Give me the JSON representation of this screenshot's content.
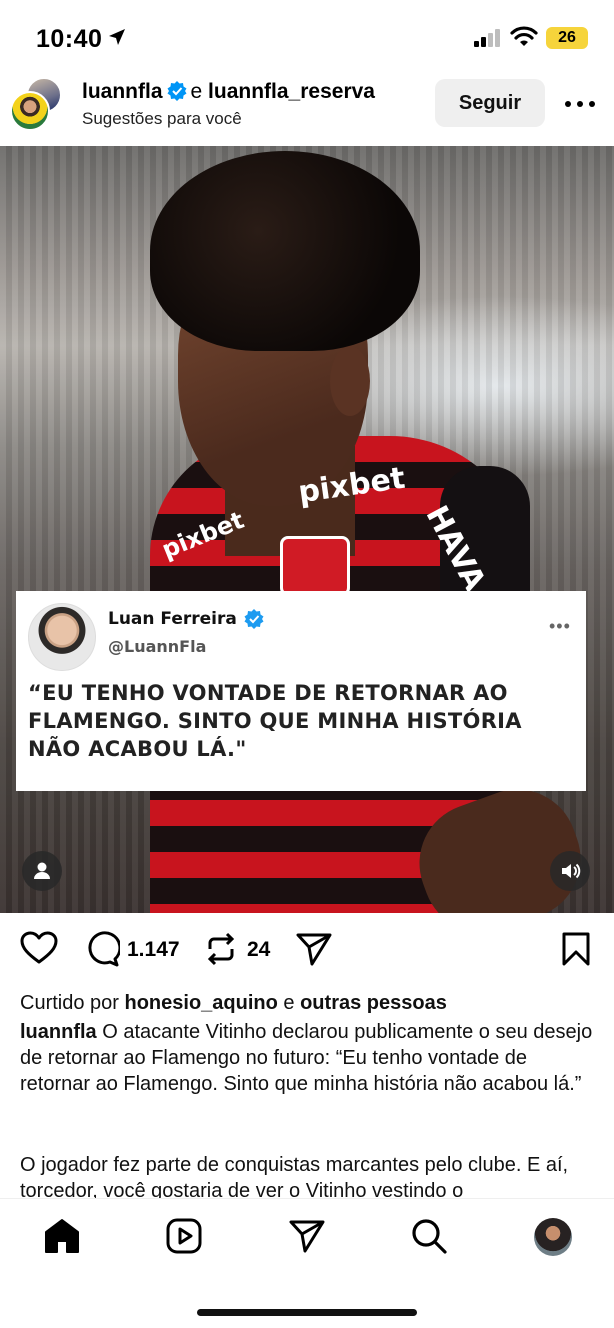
{
  "status_bar": {
    "time": "10:40",
    "battery": "26",
    "battery_color": "#f6d43b"
  },
  "post_header": {
    "user1": "luannfla",
    "conjunction": "e",
    "user2": "luannfla_reserva",
    "subtitle": "Sugestões para você",
    "follow_label": "Seguir"
  },
  "media": {
    "sponsor_text": "pixbet",
    "sponsor_text_2": "pixbet",
    "sleeve_text": "HAVA",
    "tweet": {
      "name": "Luan Ferreira",
      "handle": "@LuannFla",
      "text": "“EU TENHO VONTADE DE RETORNAR AO FLAMENGO. SINTO QUE MINHA HISTÓRIA NÃO ACABOU LÁ.\"",
      "more": "•••"
    }
  },
  "actions": {
    "comments_count": "1.147",
    "reposts_count": "24"
  },
  "likes": {
    "prefix": "Curtido por",
    "user": "honesio_aquino",
    "conj": "e",
    "others": "outras pessoas"
  },
  "caption": {
    "author": "luannfla",
    "text": "O atacante Vitinho declarou publicamente o seu desejo de retornar ao Flamengo no futuro: “Eu tenho vontade de retornar ao Flamengo. Sinto que minha história não acabou lá.”",
    "text2": "O jogador fez parte de conquistas marcantes pelo clube. E aí, torcedor, você gostaria de ver o Vitinho vestindo o"
  },
  "icons": {
    "verified_color": "#0095f6",
    "home": "home-icon",
    "reels": "reels-icon",
    "send": "send-icon",
    "search": "search-icon",
    "profile": "avatar"
  }
}
